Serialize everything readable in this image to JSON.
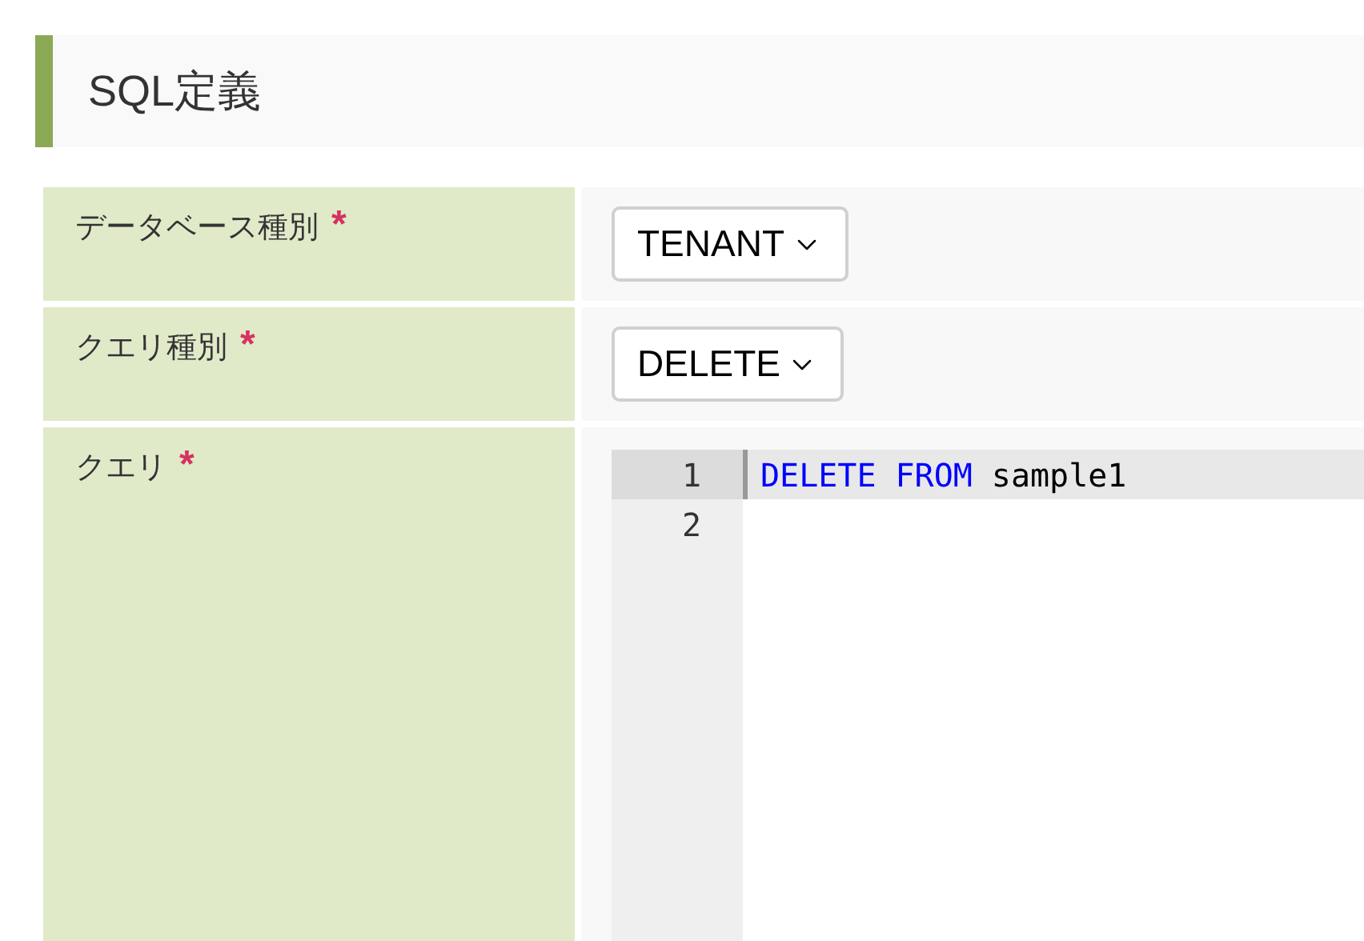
{
  "section": {
    "title": "SQL定義"
  },
  "fields": [
    {
      "kind": "select",
      "label": "データベース種別",
      "required_mark": "*",
      "value": "TENANT"
    },
    {
      "kind": "select",
      "label": "クエリ種別",
      "required_mark": "*",
      "value": "DELETE"
    },
    {
      "kind": "code",
      "label": "クエリ",
      "required_mark": "*",
      "lines": [
        {
          "number": "1",
          "active": true,
          "tokens": [
            {
              "kind": "keyword",
              "text": "DELETE"
            },
            {
              "kind": "keyword",
              "text": "FROM"
            },
            {
              "kind": "identifier",
              "text": "sample1"
            }
          ]
        },
        {
          "number": "2",
          "active": false
        }
      ]
    }
  ]
}
